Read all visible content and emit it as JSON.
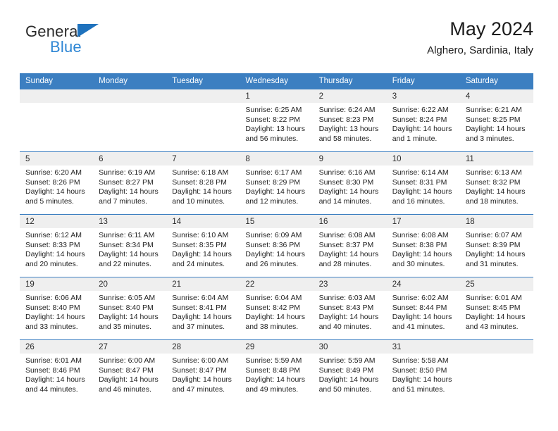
{
  "brand": {
    "name_top": "General",
    "name_bottom": "Blue",
    "triangle_color": "#1f72bd",
    "blue_text_color": "#2e86d4"
  },
  "header": {
    "title": "May 2024",
    "subtitle": "Alghero, Sardinia, Italy"
  },
  "theme": {
    "header_blue": "#3c7fc1",
    "daynum_band": "#efefef",
    "cell_background": "#ffffff",
    "text_color": "#1f1f1f"
  },
  "weekday_headers": [
    "Sunday",
    "Monday",
    "Tuesday",
    "Wednesday",
    "Thursday",
    "Friday",
    "Saturday"
  ],
  "weeks": [
    [
      {
        "day": "",
        "sunrise": "",
        "sunset": "",
        "daylight_line1": "",
        "daylight_line2": ""
      },
      {
        "day": "",
        "sunrise": "",
        "sunset": "",
        "daylight_line1": "",
        "daylight_line2": ""
      },
      {
        "day": "",
        "sunrise": "",
        "sunset": "",
        "daylight_line1": "",
        "daylight_line2": ""
      },
      {
        "day": "1",
        "sunrise": "Sunrise: 6:25 AM",
        "sunset": "Sunset: 8:22 PM",
        "daylight_line1": "Daylight: 13 hours",
        "daylight_line2": "and 56 minutes."
      },
      {
        "day": "2",
        "sunrise": "Sunrise: 6:24 AM",
        "sunset": "Sunset: 8:23 PM",
        "daylight_line1": "Daylight: 13 hours",
        "daylight_line2": "and 58 minutes."
      },
      {
        "day": "3",
        "sunrise": "Sunrise: 6:22 AM",
        "sunset": "Sunset: 8:24 PM",
        "daylight_line1": "Daylight: 14 hours",
        "daylight_line2": "and 1 minute."
      },
      {
        "day": "4",
        "sunrise": "Sunrise: 6:21 AM",
        "sunset": "Sunset: 8:25 PM",
        "daylight_line1": "Daylight: 14 hours",
        "daylight_line2": "and 3 minutes."
      }
    ],
    [
      {
        "day": "5",
        "sunrise": "Sunrise: 6:20 AM",
        "sunset": "Sunset: 8:26 PM",
        "daylight_line1": "Daylight: 14 hours",
        "daylight_line2": "and 5 minutes."
      },
      {
        "day": "6",
        "sunrise": "Sunrise: 6:19 AM",
        "sunset": "Sunset: 8:27 PM",
        "daylight_line1": "Daylight: 14 hours",
        "daylight_line2": "and 7 minutes."
      },
      {
        "day": "7",
        "sunrise": "Sunrise: 6:18 AM",
        "sunset": "Sunset: 8:28 PM",
        "daylight_line1": "Daylight: 14 hours",
        "daylight_line2": "and 10 minutes."
      },
      {
        "day": "8",
        "sunrise": "Sunrise: 6:17 AM",
        "sunset": "Sunset: 8:29 PM",
        "daylight_line1": "Daylight: 14 hours",
        "daylight_line2": "and 12 minutes."
      },
      {
        "day": "9",
        "sunrise": "Sunrise: 6:16 AM",
        "sunset": "Sunset: 8:30 PM",
        "daylight_line1": "Daylight: 14 hours",
        "daylight_line2": "and 14 minutes."
      },
      {
        "day": "10",
        "sunrise": "Sunrise: 6:14 AM",
        "sunset": "Sunset: 8:31 PM",
        "daylight_line1": "Daylight: 14 hours",
        "daylight_line2": "and 16 minutes."
      },
      {
        "day": "11",
        "sunrise": "Sunrise: 6:13 AM",
        "sunset": "Sunset: 8:32 PM",
        "daylight_line1": "Daylight: 14 hours",
        "daylight_line2": "and 18 minutes."
      }
    ],
    [
      {
        "day": "12",
        "sunrise": "Sunrise: 6:12 AM",
        "sunset": "Sunset: 8:33 PM",
        "daylight_line1": "Daylight: 14 hours",
        "daylight_line2": "and 20 minutes."
      },
      {
        "day": "13",
        "sunrise": "Sunrise: 6:11 AM",
        "sunset": "Sunset: 8:34 PM",
        "daylight_line1": "Daylight: 14 hours",
        "daylight_line2": "and 22 minutes."
      },
      {
        "day": "14",
        "sunrise": "Sunrise: 6:10 AM",
        "sunset": "Sunset: 8:35 PM",
        "daylight_line1": "Daylight: 14 hours",
        "daylight_line2": "and 24 minutes."
      },
      {
        "day": "15",
        "sunrise": "Sunrise: 6:09 AM",
        "sunset": "Sunset: 8:36 PM",
        "daylight_line1": "Daylight: 14 hours",
        "daylight_line2": "and 26 minutes."
      },
      {
        "day": "16",
        "sunrise": "Sunrise: 6:08 AM",
        "sunset": "Sunset: 8:37 PM",
        "daylight_line1": "Daylight: 14 hours",
        "daylight_line2": "and 28 minutes."
      },
      {
        "day": "17",
        "sunrise": "Sunrise: 6:08 AM",
        "sunset": "Sunset: 8:38 PM",
        "daylight_line1": "Daylight: 14 hours",
        "daylight_line2": "and 30 minutes."
      },
      {
        "day": "18",
        "sunrise": "Sunrise: 6:07 AM",
        "sunset": "Sunset: 8:39 PM",
        "daylight_line1": "Daylight: 14 hours",
        "daylight_line2": "and 31 minutes."
      }
    ],
    [
      {
        "day": "19",
        "sunrise": "Sunrise: 6:06 AM",
        "sunset": "Sunset: 8:40 PM",
        "daylight_line1": "Daylight: 14 hours",
        "daylight_line2": "and 33 minutes."
      },
      {
        "day": "20",
        "sunrise": "Sunrise: 6:05 AM",
        "sunset": "Sunset: 8:40 PM",
        "daylight_line1": "Daylight: 14 hours",
        "daylight_line2": "and 35 minutes."
      },
      {
        "day": "21",
        "sunrise": "Sunrise: 6:04 AM",
        "sunset": "Sunset: 8:41 PM",
        "daylight_line1": "Daylight: 14 hours",
        "daylight_line2": "and 37 minutes."
      },
      {
        "day": "22",
        "sunrise": "Sunrise: 6:04 AM",
        "sunset": "Sunset: 8:42 PM",
        "daylight_line1": "Daylight: 14 hours",
        "daylight_line2": "and 38 minutes."
      },
      {
        "day": "23",
        "sunrise": "Sunrise: 6:03 AM",
        "sunset": "Sunset: 8:43 PM",
        "daylight_line1": "Daylight: 14 hours",
        "daylight_line2": "and 40 minutes."
      },
      {
        "day": "24",
        "sunrise": "Sunrise: 6:02 AM",
        "sunset": "Sunset: 8:44 PM",
        "daylight_line1": "Daylight: 14 hours",
        "daylight_line2": "and 41 minutes."
      },
      {
        "day": "25",
        "sunrise": "Sunrise: 6:01 AM",
        "sunset": "Sunset: 8:45 PM",
        "daylight_line1": "Daylight: 14 hours",
        "daylight_line2": "and 43 minutes."
      }
    ],
    [
      {
        "day": "26",
        "sunrise": "Sunrise: 6:01 AM",
        "sunset": "Sunset: 8:46 PM",
        "daylight_line1": "Daylight: 14 hours",
        "daylight_line2": "and 44 minutes."
      },
      {
        "day": "27",
        "sunrise": "Sunrise: 6:00 AM",
        "sunset": "Sunset: 8:47 PM",
        "daylight_line1": "Daylight: 14 hours",
        "daylight_line2": "and 46 minutes."
      },
      {
        "day": "28",
        "sunrise": "Sunrise: 6:00 AM",
        "sunset": "Sunset: 8:47 PM",
        "daylight_line1": "Daylight: 14 hours",
        "daylight_line2": "and 47 minutes."
      },
      {
        "day": "29",
        "sunrise": "Sunrise: 5:59 AM",
        "sunset": "Sunset: 8:48 PM",
        "daylight_line1": "Daylight: 14 hours",
        "daylight_line2": "and 49 minutes."
      },
      {
        "day": "30",
        "sunrise": "Sunrise: 5:59 AM",
        "sunset": "Sunset: 8:49 PM",
        "daylight_line1": "Daylight: 14 hours",
        "daylight_line2": "and 50 minutes."
      },
      {
        "day": "31",
        "sunrise": "Sunrise: 5:58 AM",
        "sunset": "Sunset: 8:50 PM",
        "daylight_line1": "Daylight: 14 hours",
        "daylight_line2": "and 51 minutes."
      },
      {
        "day": "",
        "sunrise": "",
        "sunset": "",
        "daylight_line1": "",
        "daylight_line2": ""
      }
    ]
  ]
}
